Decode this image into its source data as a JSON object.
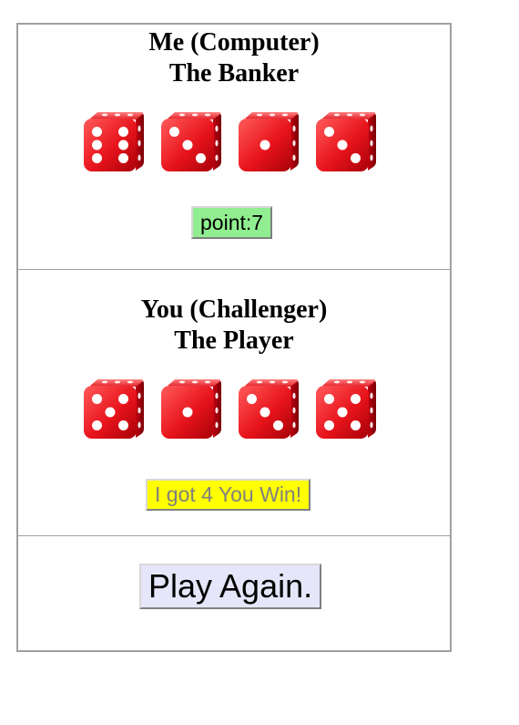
{
  "banker": {
    "title_line1": "Me (Computer)",
    "title_line2": "The Banker",
    "dice": [
      6,
      3,
      1,
      3
    ],
    "point_text": "point:7",
    "point_color": "#90ee90"
  },
  "player": {
    "title_line1": "You (Challenger)",
    "title_line2": "The Player",
    "dice": [
      5,
      1,
      3,
      5
    ],
    "result_text": "I got 4 You Win!",
    "result_color": "#ffff00"
  },
  "actions": {
    "play_again_label": "Play Again."
  },
  "colors": {
    "die_face": "#e8141c",
    "die_pip": "#ffffff",
    "border": "#a0a0a0"
  }
}
